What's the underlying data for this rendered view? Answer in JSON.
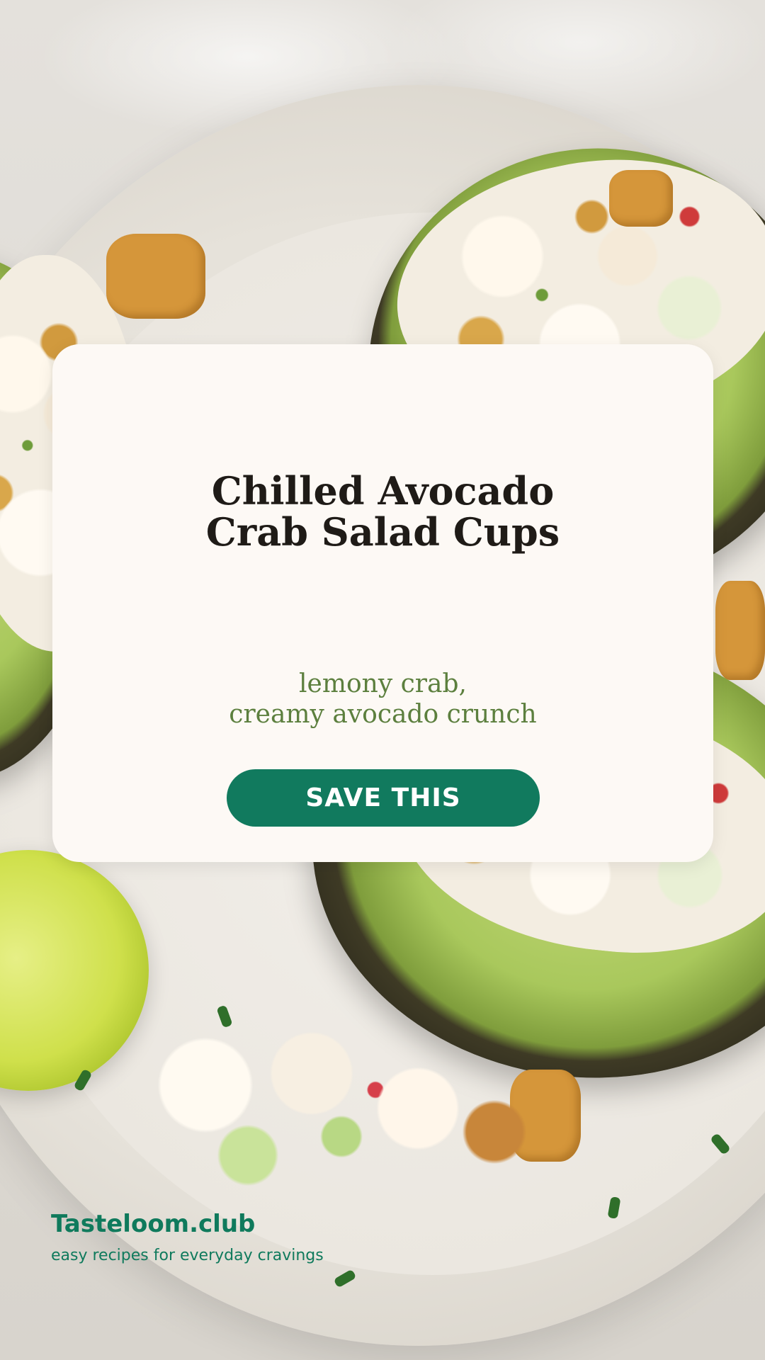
{
  "card": {
    "title_line1": "Chilled Avocado",
    "title_line2": "Crab Salad Cups",
    "subtitle_line1": "lemony crab,",
    "subtitle_line2": "creamy avocado crunch",
    "cta_label": "SAVE THIS"
  },
  "brand": {
    "name": "Tasteloom.club",
    "tagline": "easy recipes for everyday cravings"
  },
  "colors": {
    "card_background": "#fdf9f5",
    "title": "#1f1b17",
    "subtitle": "#5c7f3e",
    "cta_background": "#117a5e",
    "cta_text": "#ffffff",
    "brand": "#0f7a5c"
  }
}
